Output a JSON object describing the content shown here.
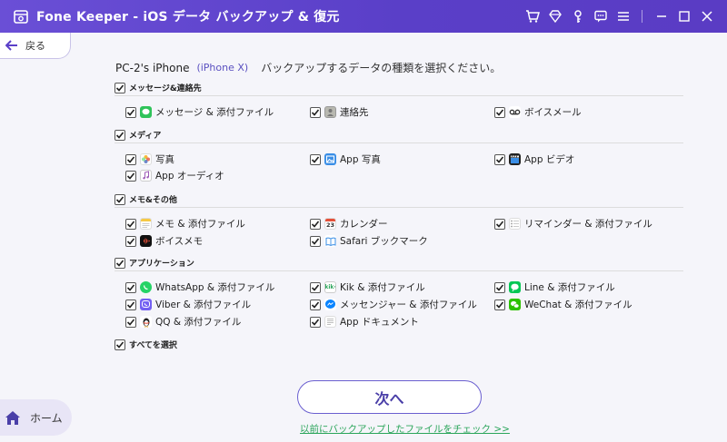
{
  "titlebar": {
    "title": "Fone Keeper - iOS データ バックアップ & 復元"
  },
  "nav": {
    "back_label": "戻る",
    "home_label": "ホーム"
  },
  "header": {
    "device_name": "PC-2's iPhone",
    "device_model": "(iPhone X)",
    "instruction": "バックアップするデータの種類を選択ください。"
  },
  "categories": {
    "messages": "メッセージ&連絡先",
    "media": "メディア",
    "memos": "メモ&その他",
    "apps": "アプリケーション",
    "select_all": "すべてを選択"
  },
  "items": {
    "messages_attachments": "メッセージ & 添付ファイル",
    "contacts": "連絡先",
    "voicemail": "ボイスメール",
    "photos": "写真",
    "app_photos": "App 写真",
    "app_video": "App ビデオ",
    "app_audio": "App オーディオ",
    "notes_attachments": "メモ & 添付ファイル",
    "calendar": "カレンダー",
    "reminders_attachments": "リマインダー & 添付ファイル",
    "voice_memos": "ボイスメモ",
    "safari_bookmarks": "Safari ブックマーク",
    "whatsapp": "WhatsApp & 添付ファイル",
    "kik": "Kik & 添付ファイル",
    "line": "Line & 添付ファイル",
    "viber": "Viber & 添付ファイル",
    "messenger": "メッセンジャー & 添付ファイル",
    "wechat": "WeChat & 添付ファイル",
    "qq": "QQ & 添付ファイル",
    "app_documents": "App ドキュメント"
  },
  "actions": {
    "next_label": "次へ",
    "check_backup_link": "以前にバックアップしたファイルをチェック >>"
  },
  "calendar_day": "23",
  "colors": {
    "accent": "#5a3fc8",
    "link": "#2aa55a"
  }
}
